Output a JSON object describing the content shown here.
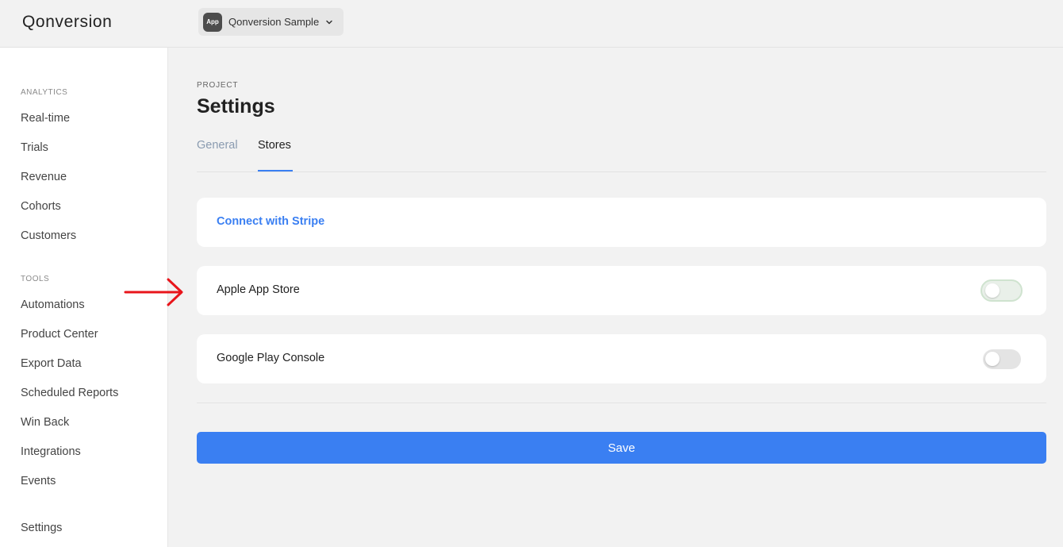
{
  "header": {
    "logo": "Qonversion",
    "app_badge": "App",
    "app_name": "Qonversion Sample"
  },
  "sidebar": {
    "analytics_heading": "ANALYTICS",
    "analytics_items": [
      "Real-time",
      "Trials",
      "Revenue",
      "Cohorts",
      "Customers"
    ],
    "tools_heading": "TOOLS",
    "tools_items": [
      "Automations",
      "Product Center",
      "Export Data",
      "Scheduled Reports",
      "Win Back",
      "Integrations",
      "Events"
    ],
    "settings_label": "Settings"
  },
  "main": {
    "breadcrumb": "PROJECT",
    "title": "Settings",
    "tabs": [
      {
        "label": "General",
        "active": false
      },
      {
        "label": "Stores",
        "active": true
      }
    ],
    "stripe_link": "Connect with Stripe",
    "stores": [
      {
        "label": "Apple App Store",
        "enabled": false
      },
      {
        "label": "Google Play Console",
        "enabled": false
      }
    ],
    "save_label": "Save"
  },
  "colors": {
    "accent": "#3a7ff2",
    "annotation_arrow": "#e8151b"
  },
  "icons": {
    "app_switcher_chevron": "chevron-down-icon",
    "annotation": "arrow-right-icon"
  }
}
